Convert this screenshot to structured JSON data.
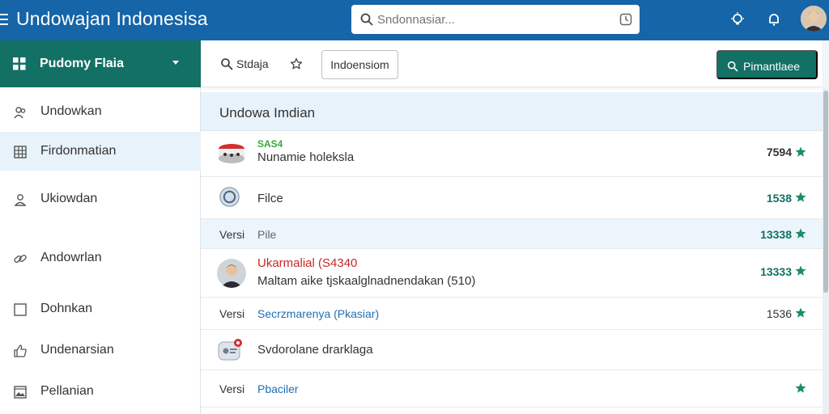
{
  "app": {
    "title": "Undowajan Indonesisa"
  },
  "search": {
    "placeholder": "Sndonnasiar..."
  },
  "sidebar": {
    "header": "Pudomy Flaia",
    "items": [
      {
        "label": "Undowkan",
        "icon": "people-icon",
        "active": false
      },
      {
        "label": "Firdonmatian",
        "icon": "calendar-grid-icon",
        "active": true
      },
      {
        "label": "Ukiowdan",
        "icon": "person-icon",
        "active": false
      },
      {
        "label": "Andowrlan",
        "icon": "link-icon",
        "active": false
      },
      {
        "label": "Dohnkan",
        "icon": "square-icon",
        "active": false
      },
      {
        "label": "Undenarsian",
        "icon": "thumb-up-icon",
        "active": false
      },
      {
        "label": "Pellanian",
        "icon": "image-icon",
        "active": false
      }
    ]
  },
  "toolbar": {
    "search_label": "Stdaja",
    "chip_label": "Indoensiom",
    "primary_label": "Pimantlaee"
  },
  "section": {
    "title": "Undowa Imdian"
  },
  "rows": [
    {
      "tag": "SAS4",
      "text": "Nunamie holeksla",
      "value": "7594",
      "value_color": "#333333"
    },
    {
      "text": "Filce",
      "value": "1538",
      "value_color": "#137064"
    },
    {
      "ver": "Versi",
      "text": "Pile",
      "value": "13338",
      "value_color": "#137064"
    },
    {
      "title": "Ukarmalial (S4340",
      "text": "Maltam aike tjskaalglnadnendakan (510)",
      "value": "13333",
      "value_color": "#137064"
    },
    {
      "ver": "Versi",
      "text": "Secrzmarenya (Pkasiar)",
      "value": "1536",
      "value_color": "#333333"
    },
    {
      "text": "Svdorolane drarklaga",
      "value": "",
      "value_color": "#333333"
    },
    {
      "ver": "Versi",
      "text": "Pbaciler",
      "value": "",
      "value_color": "#137064"
    }
  ],
  "colors": {
    "topbar": "#1565a8",
    "teal": "#137064",
    "star": "#1a8e66",
    "highlight": "#e8f2fb",
    "red": "#c62828",
    "link": "#1e6fb5"
  }
}
